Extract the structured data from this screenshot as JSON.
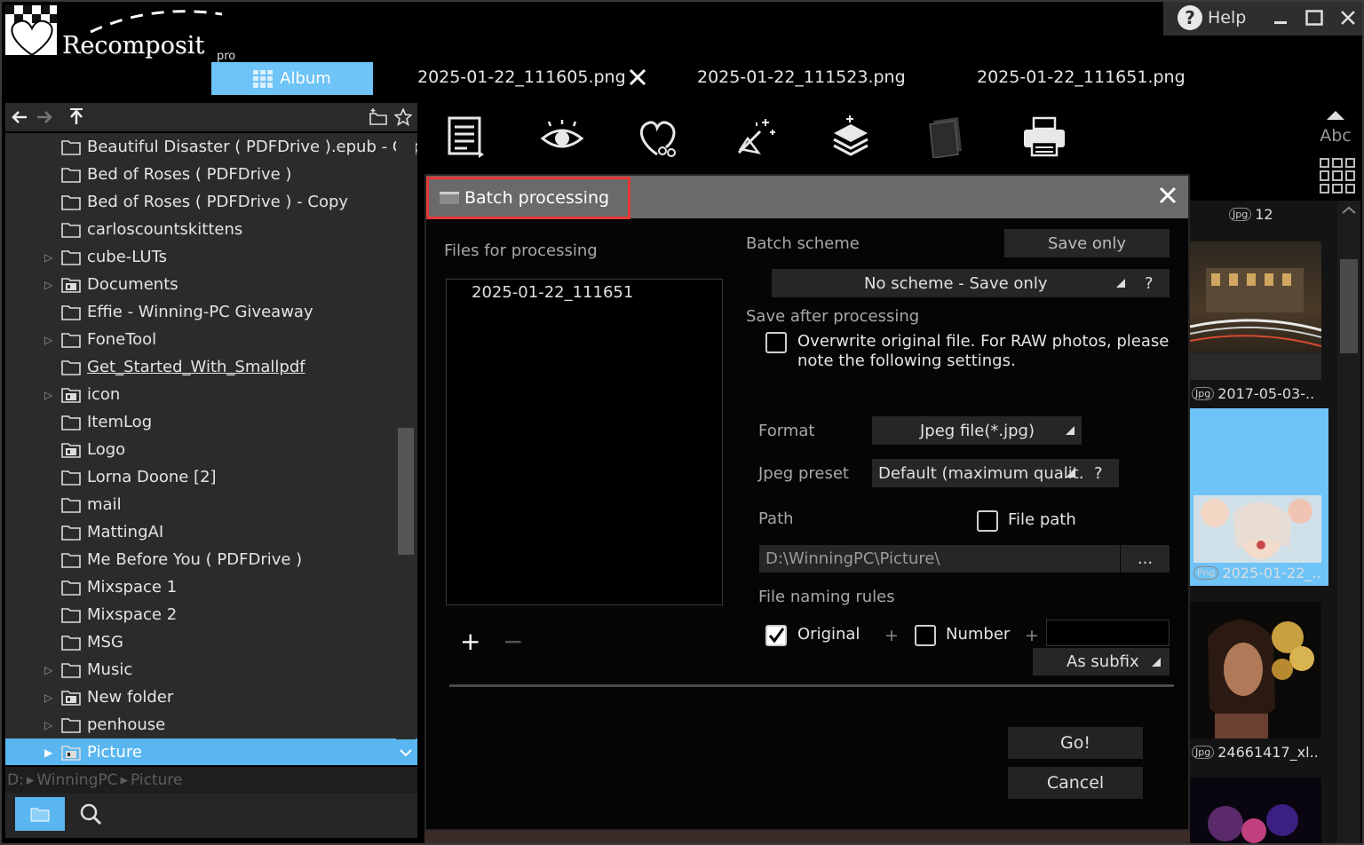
{
  "app": {
    "name": "Recomposit",
    "edition": "pro",
    "help_label": "Help",
    "album_label": "Album"
  },
  "tabs": [
    {
      "label": "2025-01-22_111605.png"
    },
    {
      "label": "2025-01-22_111523.png"
    },
    {
      "label": "2025-01-22_111651.png"
    }
  ],
  "toolbar": {
    "tools": [
      "list-icon",
      "eye-icon",
      "heart-scissors-icon",
      "magic-wand-icon",
      "layers-icon",
      "stack-icon",
      "printer-icon"
    ],
    "sort_label": "Abc"
  },
  "tree": {
    "items": [
      {
        "label": "Beautiful Disaster ( PDFDrive ).epub - Copy",
        "expandable": false,
        "icon": "folder"
      },
      {
        "label": "Bed of Roses ( PDFDrive )",
        "expandable": false,
        "icon": "folder"
      },
      {
        "label": "Bed of Roses ( PDFDrive ) - Copy",
        "expandable": false,
        "icon": "folder"
      },
      {
        "label": "carloscountskittens",
        "expandable": false,
        "icon": "folder"
      },
      {
        "label": "cube-LUTs",
        "expandable": true,
        "icon": "folder"
      },
      {
        "label": "Documents",
        "expandable": true,
        "icon": "folder-image"
      },
      {
        "label": "Effie - Winning-PC Giveaway",
        "expandable": false,
        "icon": "folder"
      },
      {
        "label": "FoneTool",
        "expandable": true,
        "icon": "folder"
      },
      {
        "label": "Get_Started_With_Smallpdf",
        "expandable": false,
        "icon": "folder"
      },
      {
        "label": "icon",
        "expandable": true,
        "icon": "folder-image"
      },
      {
        "label": "ItemLog",
        "expandable": false,
        "icon": "folder"
      },
      {
        "label": "Logo",
        "expandable": false,
        "icon": "folder-image"
      },
      {
        "label": "Lorna Doone [2]",
        "expandable": false,
        "icon": "folder"
      },
      {
        "label": "mail",
        "expandable": false,
        "icon": "folder"
      },
      {
        "label": "MattingAI",
        "expandable": false,
        "icon": "folder"
      },
      {
        "label": "Me Before You ( PDFDrive )",
        "expandable": false,
        "icon": "folder"
      },
      {
        "label": "Mixspace 1",
        "expandable": false,
        "icon": "folder"
      },
      {
        "label": "Mixspace 2",
        "expandable": false,
        "icon": "folder"
      },
      {
        "label": "MSG",
        "expandable": false,
        "icon": "folder"
      },
      {
        "label": "Music",
        "expandable": true,
        "icon": "folder"
      },
      {
        "label": "New folder",
        "expandable": true,
        "icon": "folder-image"
      },
      {
        "label": "penhouse",
        "expandable": true,
        "icon": "folder"
      },
      {
        "label": "Picture",
        "expandable": true,
        "icon": "folder-image",
        "selected": true
      }
    ]
  },
  "path": {
    "drive": "D:",
    "segments": [
      "WinningPC",
      "Picture"
    ],
    "separator": "▸"
  },
  "thumbnails": {
    "count_badge": "Jpg",
    "count": "12",
    "items": [
      {
        "format": "Jpg",
        "caption": "2017-05-03-..",
        "selected": false
      },
      {
        "format": "Png",
        "caption": "2025-01-22_..",
        "selected": true
      },
      {
        "format": "Jpg",
        "caption": "24661417_xl..",
        "selected": false
      }
    ]
  },
  "dialog": {
    "title": "Batch processing",
    "files_label": "Files for processing",
    "files": [
      "2025-01-22_111651"
    ],
    "add_label": "+",
    "remove_label": "−",
    "batch_scheme_label": "Batch scheme",
    "save_only_button": "Save only",
    "scheme_value": "No scheme - Save only",
    "help_q": "?",
    "save_after_label": "Save after processing",
    "overwrite_label_1": "Overwrite original file. For RAW photos, please",
    "overwrite_label_2": "note the following settings.",
    "overwrite_checked": false,
    "format_label": "Format",
    "format_value": "Jpeg file(*.jpg)",
    "jpeg_preset_label": "Jpeg preset",
    "jpeg_preset_value": "Default (maximum qualit.",
    "path_label": "Path",
    "file_path_label": "File path",
    "file_path_checked": false,
    "path_value": "D:\\WinningPC\\Picture\\",
    "browse_label": "...",
    "naming_label": "File naming rules",
    "original_label": "Original",
    "original_checked": true,
    "plus_sign": "+",
    "number_label": "Number",
    "number_checked": false,
    "suffix_value": "",
    "as_subfix_value": "As subfix",
    "go_label": "Go!",
    "cancel_label": "Cancel"
  },
  "colors": {
    "accent": "#59b6f0",
    "highlight_box": "#e53935",
    "panel_bg": "#2b2b2b",
    "dialog_bg": "#050505"
  }
}
